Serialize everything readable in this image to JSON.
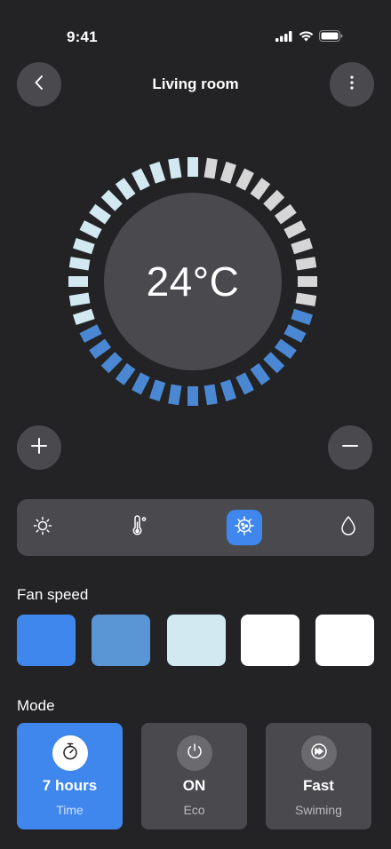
{
  "status_bar": {
    "time": "9:41"
  },
  "header": {
    "title": "Living room"
  },
  "thermostat": {
    "temperature": "24°C"
  },
  "fan_speed": {
    "label": "Fan speed",
    "colors": [
      "#3f87ec",
      "#5a95d6",
      "#d3e9f1",
      "#ffffff",
      "#ffffff"
    ]
  },
  "mode": {
    "label": "Mode",
    "cards": [
      {
        "icon": "timer-icon",
        "value": "7 hours",
        "sub": "Time",
        "active": true
      },
      {
        "icon": "power-icon",
        "value": "ON",
        "sub": "Eco",
        "active": false
      },
      {
        "icon": "fast-forward-icon",
        "value": "Fast",
        "sub": "Swiming",
        "active": false
      }
    ]
  },
  "mode_bar": {
    "icons": [
      "sun-icon",
      "thermometer-icon",
      "virus-icon",
      "droplet-icon"
    ],
    "active": "virus-icon"
  },
  "colors": {
    "background": "#232325",
    "surface": "#4a4a4e",
    "accent": "#3f87ec",
    "dial_light": "#d3e9f1",
    "dial_gray": "#d6d6d6",
    "dial_blue": "#4a88d4"
  }
}
